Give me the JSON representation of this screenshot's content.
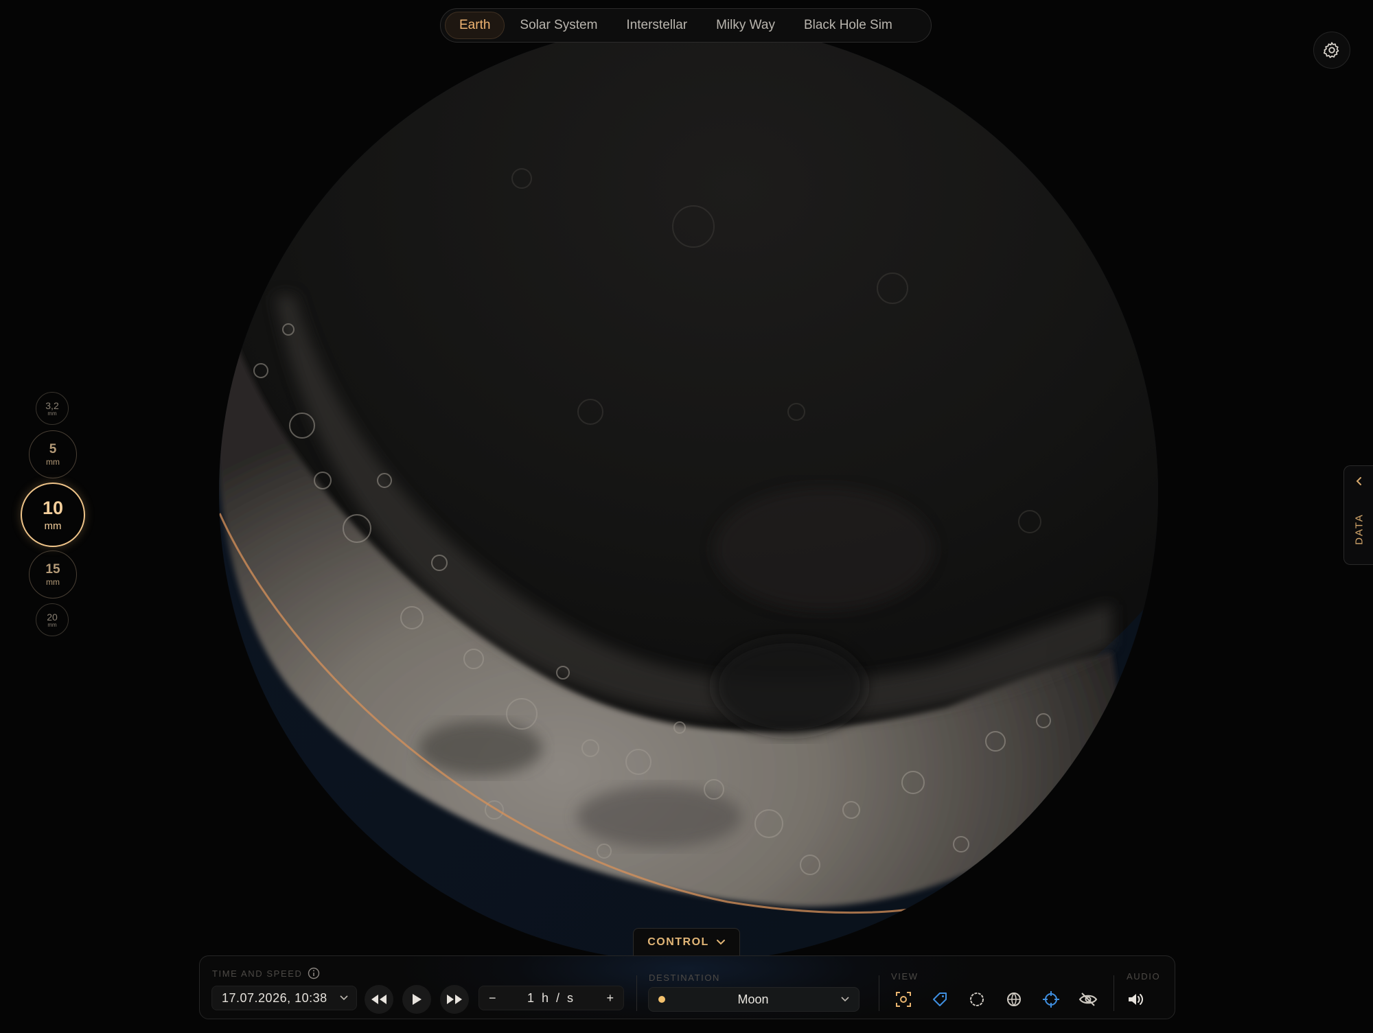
{
  "nav": {
    "tabs": [
      {
        "label": "Earth",
        "active": true
      },
      {
        "label": "Solar System",
        "active": false
      },
      {
        "label": "Interstellar",
        "active": false
      },
      {
        "label": "Milky Way",
        "active": false
      },
      {
        "label": "Black Hole Sim",
        "active": false
      }
    ]
  },
  "settings": {
    "icon": "gear-icon"
  },
  "zoom": {
    "options": [
      {
        "value": "3,2",
        "unit": "mm"
      },
      {
        "value": "5",
        "unit": "mm"
      },
      {
        "value": "10",
        "unit": "mm",
        "selected": true
      },
      {
        "value": "15",
        "unit": "mm"
      },
      {
        "value": "20",
        "unit": "mm"
      }
    ]
  },
  "data_tab": {
    "label": "DATA",
    "icon": "chevron-left-icon"
  },
  "control": {
    "toggle_label": "CONTROL",
    "time_speed": {
      "label": "TIME AND SPEED",
      "datetime": "17.07.2026, 10:38",
      "speed_value": "1 h / s",
      "minus": "−",
      "plus": "+"
    },
    "destination": {
      "label": "DESTINATION",
      "value": "Moon",
      "dot_color": "#f3c16d"
    },
    "view": {
      "label": "VIEW"
    },
    "audio": {
      "label": "AUDIO"
    }
  },
  "colors": {
    "accent": "#efb472",
    "blue_icon": "#3f8fe0",
    "background": "#050505"
  }
}
